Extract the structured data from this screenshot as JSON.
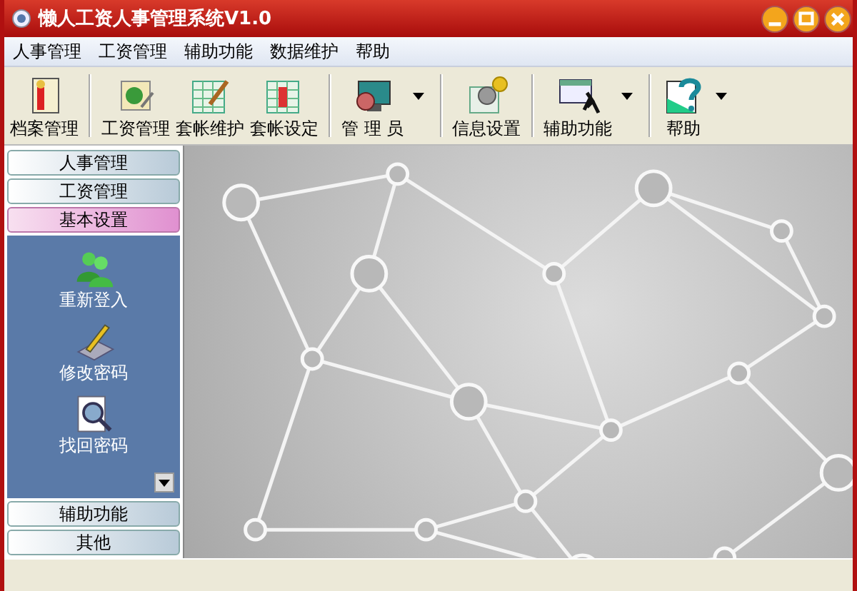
{
  "window": {
    "title": "懒人工资人事管理系统V1.0"
  },
  "menu": [
    "人事管理",
    "工资管理",
    "辅助功能",
    "数据维护",
    "帮助"
  ],
  "toolbar_groups": [
    {
      "buttons": [
        {
          "label": "档案管理",
          "dropdown": false
        }
      ]
    },
    {
      "buttons": [
        {
          "label": "工资管理",
          "dropdown": false
        },
        {
          "label": "套帐维护",
          "dropdown": false
        },
        {
          "label": "套帐设定",
          "dropdown": false
        }
      ]
    },
    {
      "buttons": [
        {
          "label": "管 理 员",
          "dropdown": true
        }
      ]
    },
    {
      "buttons": [
        {
          "label": "信息设置",
          "dropdown": false
        }
      ]
    },
    {
      "buttons": [
        {
          "label": "辅助功能",
          "dropdown": true
        }
      ]
    },
    {
      "buttons": [
        {
          "label": "帮助",
          "dropdown": true
        }
      ]
    }
  ],
  "sidebar": {
    "sections": [
      {
        "label": "人事管理",
        "selected": false
      },
      {
        "label": "工资管理",
        "selected": false
      },
      {
        "label": "基本设置",
        "selected": true,
        "items": [
          "重新登入",
          "修改密码",
          "找回密码"
        ]
      },
      {
        "label": "辅助功能",
        "selected": false
      },
      {
        "label": "其他",
        "selected": false
      }
    ]
  }
}
